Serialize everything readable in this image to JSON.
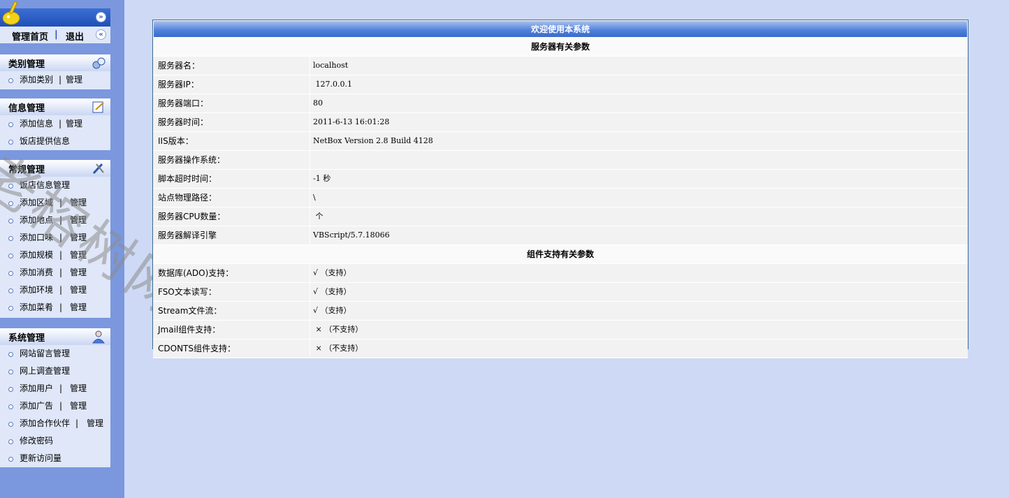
{
  "sidebar": {
    "top_links": {
      "home": "管理首页",
      "separator": "|",
      "logout": "退出"
    },
    "groups": [
      {
        "title": "类别管理",
        "icon": "category-icon",
        "items": [
          {
            "a": "添加类别",
            "b": "管理"
          }
        ]
      },
      {
        "title": "信息管理",
        "icon": "edit-icon",
        "items": [
          {
            "a": "添加信息",
            "b": "管理"
          },
          {
            "a": "饭店提供信息",
            "b": ""
          }
        ]
      },
      {
        "title": "常规管理",
        "icon": "tools-icon",
        "items": [
          {
            "a": "饭店信息管理",
            "b": ""
          },
          {
            "a": "添加区域",
            "b": "管理"
          },
          {
            "a": "添加地点",
            "b": "管理"
          },
          {
            "a": "添加口味",
            "b": "管理"
          },
          {
            "a": "添加规模",
            "b": "管理"
          },
          {
            "a": "添加消费",
            "b": "管理"
          },
          {
            "a": "添加环境",
            "b": "管理"
          },
          {
            "a": "添加菜肴",
            "b": "管理"
          }
        ]
      },
      {
        "title": "系统管理",
        "icon": "user-icon",
        "items": [
          {
            "a": "网站留言管理",
            "b": ""
          },
          {
            "a": "网上调查管理",
            "b": ""
          },
          {
            "a": "添加用户",
            "b": "管理"
          },
          {
            "a": "添加广告",
            "b": "管理"
          },
          {
            "a": "添加合作伙伴",
            "b": "管理"
          },
          {
            "a": "修改密码",
            "b": ""
          },
          {
            "a": "更新访问量",
            "b": ""
          }
        ]
      }
    ]
  },
  "watermark": "老榕树网络",
  "panel": {
    "title": "欢迎使用本系统",
    "server_section": "服务器有关参数",
    "server_rows": [
      {
        "k": "服务器名：",
        "v": "localhost"
      },
      {
        "k": "服务器IP：",
        "v": " 127.0.0.1"
      },
      {
        "k": "服务器端口：",
        "v": "80"
      },
      {
        "k": "服务器时间：",
        "v": "2011-6-13 16:01:28"
      },
      {
        "k": "IIS版本：",
        "v": "NetBox Version 2.8 Build 4128"
      },
      {
        "k": "服务器操作系统：",
        "v": ""
      },
      {
        "k": "脚本超时时间：",
        "v": "-1 秒"
      },
      {
        "k": "站点物理路径：",
        "v": "\\"
      },
      {
        "k": "服务器CPU数量：",
        "v": " 个"
      },
      {
        "k": "服务器解译引擎",
        "v": "VBScript/5.7.18066"
      }
    ],
    "component_section": "组件支持有关参数",
    "component_rows": [
      {
        "k": "数据库(ADO)支持：",
        "v": "√ （支持）"
      },
      {
        "k": "FSO文本读写：",
        "v": "√ （支持）"
      },
      {
        "k": "Stream文件流：",
        "v": "√ （支持）"
      },
      {
        "k": "Jmail组件支持：",
        "v": " × （不支持）"
      },
      {
        "k": "CDONTS组件支持：",
        "v": " × （不支持）"
      }
    ]
  }
}
